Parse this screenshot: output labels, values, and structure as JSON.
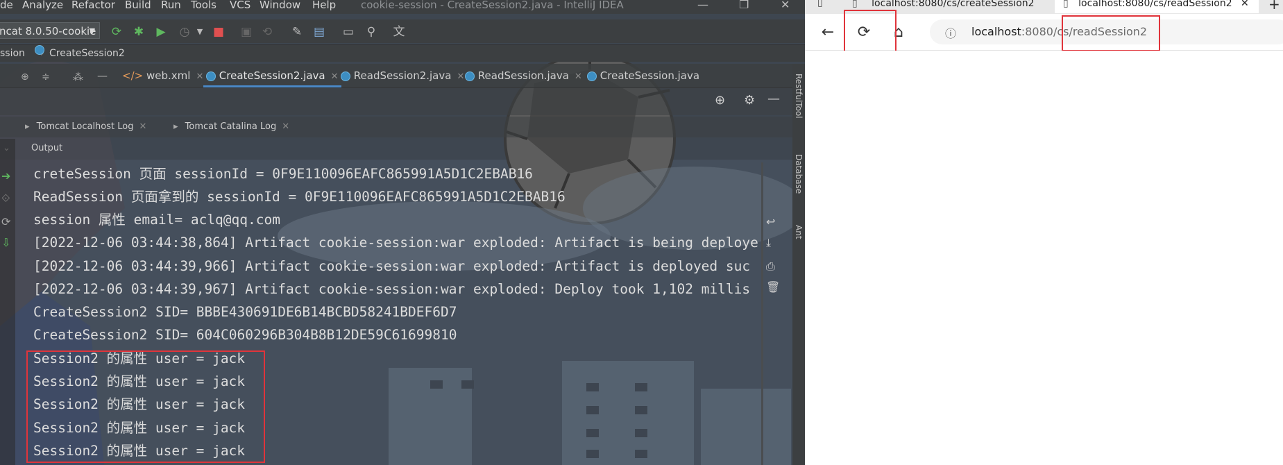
{
  "ide": {
    "window_title": "cookie-session - CreateSession2.java - IntelliJ IDEA",
    "menu": [
      "de",
      "Analyze",
      "Refactor",
      "Build",
      "Run",
      "Tools",
      "VCS",
      "Window",
      "Help"
    ],
    "run_config": "ncat 8.0.50-cookie",
    "breadcrumb": [
      "ssion",
      "CreateSession2"
    ],
    "editor_tabs": [
      {
        "label": "web.xml",
        "active": false
      },
      {
        "label": "CreateSession2.java",
        "active": true
      },
      {
        "label": "ReadSession2.java",
        "active": false
      },
      {
        "label": "ReadSession.java",
        "active": false
      },
      {
        "label": "CreateSession.java",
        "active": false
      }
    ],
    "log_tabs": [
      "Tomcat Localhost Log",
      "Tomcat Catalina Log"
    ],
    "output_label": "Output",
    "console_lines": [
      "creteSession 页面 sessionId = 0F9E110096EAFC865991A5D1C2EBAB16",
      "ReadSession 页面拿到的 sessionId = 0F9E110096EAFC865991A5D1C2EBAB16",
      "session 属性 email= aclq@qq.com",
      "[2022-12-06 03:44:38,864] Artifact cookie-session:war exploded: Artifact is being deploye",
      "[2022-12-06 03:44:39,966] Artifact cookie-session:war exploded: Artifact is deployed suc",
      "[2022-12-06 03:44:39,967] Artifact cookie-session:war exploded: Deploy took 1,102 millis",
      "CreateSession2 SID= BBBE430691DE6B14BCBD58241BDEF6D7",
      "CreateSession2 SID= 604C060296B304B8B12DE59C61699810",
      "Session2 的属性 user = jack",
      "Session2 的属性 user = jack",
      "Session2 的属性 user = jack",
      "Session2 的属性 user = jack",
      "Session2 的属性 user = jack"
    ],
    "side_tools": [
      "RestfulTool",
      "Database",
      "Ant"
    ]
  },
  "browser": {
    "tabs": [
      {
        "label": "localhost:8080/cs/createSession2",
        "active": false
      },
      {
        "label": "localhost:8080/cs/readSession2",
        "active": true
      }
    ],
    "url_host": "localhost",
    "url_rest": ":8080/cs/readSession2"
  },
  "colors": {
    "highlight_box": "#e0343b",
    "ide_bg": "#3c3f41",
    "active_tab_underline": "#4a88c7"
  }
}
